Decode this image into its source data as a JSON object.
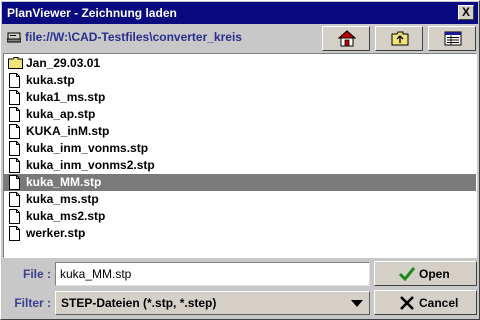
{
  "window": {
    "title": "PlanViewer - Zeichnung laden",
    "close_glyph": "X"
  },
  "pathbar": {
    "path": "file://W:\\CAD-Testfiles\\converter_kreis",
    "icon": "drive-icon"
  },
  "toolbar": [
    {
      "name": "home-button",
      "icon": "home-icon"
    },
    {
      "name": "up-folder-button",
      "icon": "folder-up-icon"
    },
    {
      "name": "details-view-button",
      "icon": "details-view-icon"
    }
  ],
  "files": [
    {
      "name": "Jan_29.03.01",
      "type": "folder",
      "selected": false
    },
    {
      "name": "kuka.stp",
      "type": "file",
      "selected": false
    },
    {
      "name": "kuka1_ms.stp",
      "type": "file",
      "selected": false
    },
    {
      "name": "kuka_ap.stp",
      "type": "file",
      "selected": false
    },
    {
      "name": "KUKA_inM.stp",
      "type": "file",
      "selected": false
    },
    {
      "name": "kuka_inm_vonms.stp",
      "type": "file",
      "selected": false
    },
    {
      "name": "kuka_inm_vonms2.stp",
      "type": "file",
      "selected": false
    },
    {
      "name": "kuka_MM.stp",
      "type": "file",
      "selected": true
    },
    {
      "name": "kuka_ms.stp",
      "type": "file",
      "selected": false
    },
    {
      "name": "kuka_ms2.stp",
      "type": "file",
      "selected": false
    },
    {
      "name": "werker.stp",
      "type": "file",
      "selected": false
    }
  ],
  "file_field": {
    "label": "File :",
    "value": "kuka_MM.stp"
  },
  "filter_field": {
    "label": "Filter :",
    "value": "STEP-Dateien (*.stp, *.step)"
  },
  "buttons": {
    "open_label": "Open",
    "cancel_label": "Cancel"
  },
  "colors": {
    "titlebar": "#0a0a80",
    "selection": "#7a7a7a",
    "label": "#3b3f8f",
    "open_check": "#1a8a1a"
  }
}
